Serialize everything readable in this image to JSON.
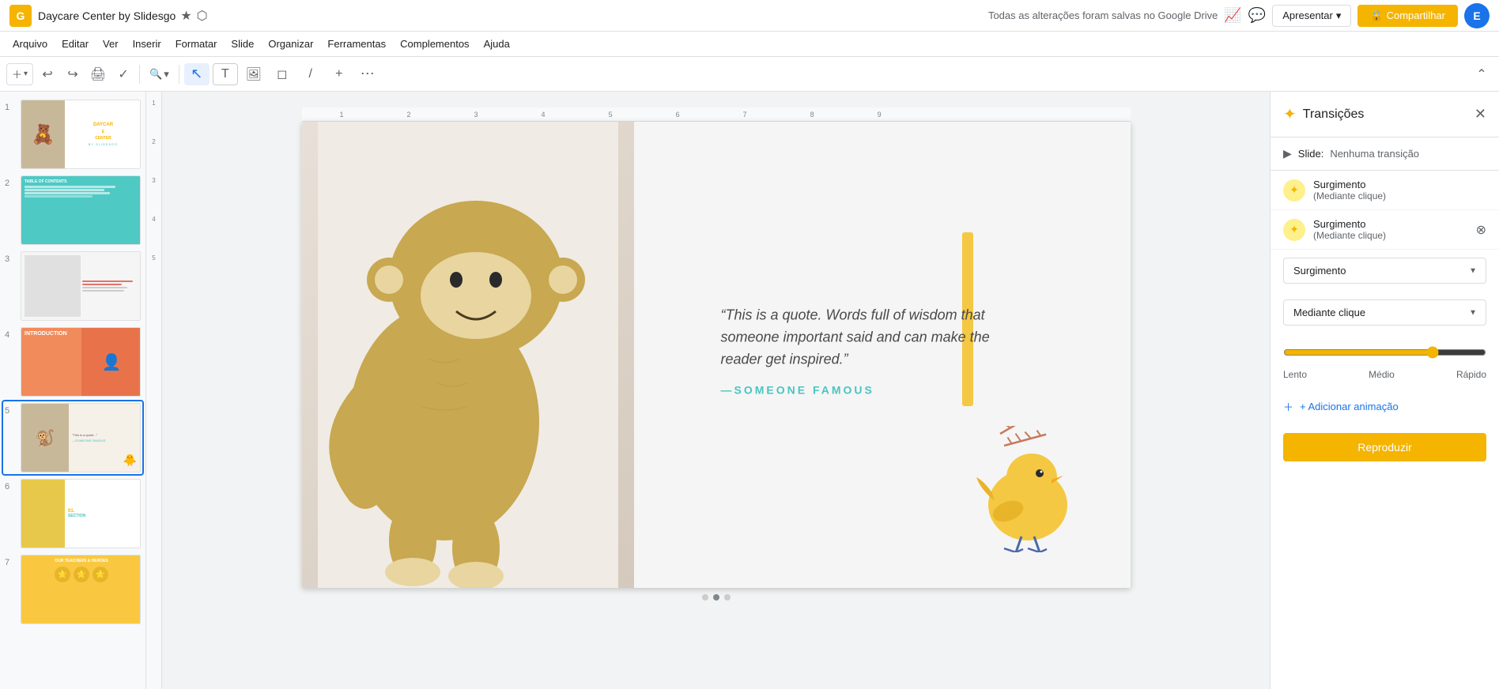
{
  "app": {
    "title": "Daycare Center by Slidesgo",
    "icon": "G",
    "avatar_letter": "E"
  },
  "topbar": {
    "star_label": "★",
    "folder_label": "⬡",
    "saved_text": "Todas as alterações foram salvas no Google Drive",
    "present_label": "Apresentar",
    "share_label": "Compartilhar",
    "lock_icon": "🔒"
  },
  "menubar": {
    "items": [
      "Arquivo",
      "Editar",
      "Ver",
      "Inserir",
      "Formatar",
      "Slide",
      "Organizar",
      "Ferramentas",
      "Complementos",
      "Ajuda"
    ]
  },
  "toolbar": {
    "zoom_level": "▾",
    "collapse_icon": "⌃"
  },
  "slide_panel": {
    "slides": [
      {
        "num": "1",
        "label": "slide-1"
      },
      {
        "num": "2",
        "label": "slide-2"
      },
      {
        "num": "3",
        "label": "slide-3"
      },
      {
        "num": "4",
        "label": "slide-4"
      },
      {
        "num": "5",
        "label": "slide-5"
      },
      {
        "num": "6",
        "label": "slide-6"
      },
      {
        "num": "7",
        "label": "slide-7"
      }
    ]
  },
  "canvas": {
    "quote_text": "“This is a quote. Words full of wisdom that someone important said and can make the reader get inspired.”",
    "quote_author": "—SOMEONE FAMOUS"
  },
  "right_panel": {
    "title": "Transições",
    "slide_transition_label": "Slide:",
    "slide_transition_value": "Nenhuma transição",
    "animations": [
      {
        "name": "Surgimento",
        "trigger": "(Mediante clique)"
      },
      {
        "name": "Surgimento",
        "trigger": "(Mediante clique)"
      }
    ],
    "animation_type_label": "Surgimento",
    "trigger_label": "Mediante clique",
    "speed_labels": [
      "Lento",
      "Médio",
      "Rápido"
    ],
    "speed_value": 75,
    "add_animation_label": "+ Adicionar animação",
    "reproduce_label": "Reproduzir"
  }
}
